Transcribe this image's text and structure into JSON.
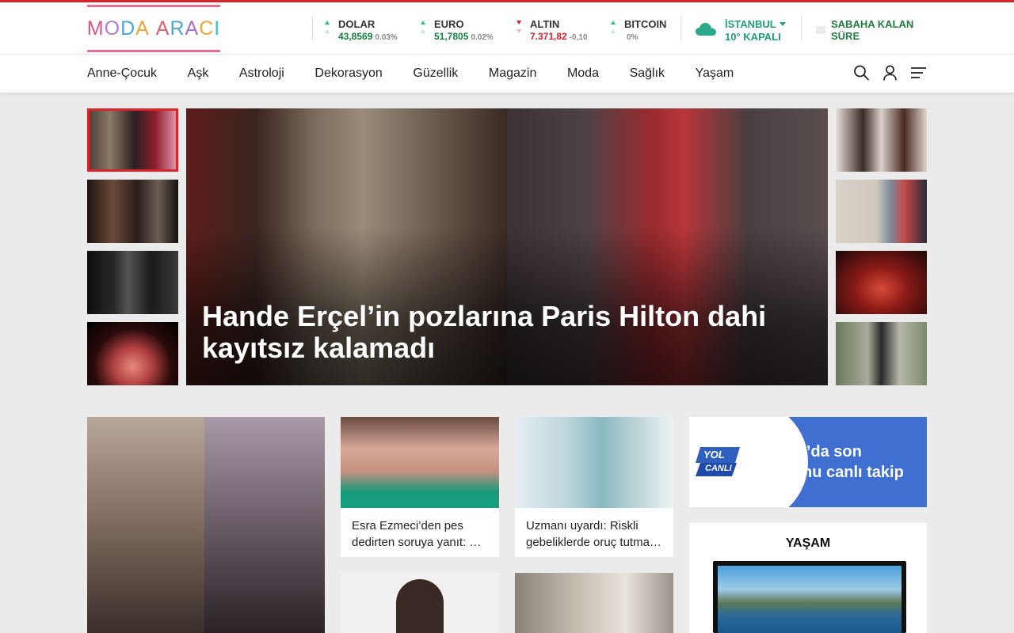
{
  "header": {
    "logo_letters": [
      {
        "ch": "M",
        "color": "#d6538c"
      },
      {
        "ch": "O",
        "color": "#b57ccd"
      },
      {
        "ch": "D",
        "color": "#4ea3d8"
      },
      {
        "ch": "A",
        "color": "#f0a33a"
      },
      {
        "ch": " ",
        "color": "#ffffff"
      },
      {
        "ch": "A",
        "color": "#e25f6b"
      },
      {
        "ch": "R",
        "color": "#4ea3d8"
      },
      {
        "ch": "A",
        "color": "#a46ed0"
      },
      {
        "ch": "C",
        "color": "#f0a33a"
      },
      {
        "ch": "I",
        "color": "#3cc0c8"
      }
    ],
    "markets": [
      {
        "name": "DOLAR",
        "value": "43,8569",
        "change": "0.03%",
        "trend": "up"
      },
      {
        "name": "EURO",
        "value": "51,7805",
        "change": "0.02%",
        "trend": "up"
      },
      {
        "name": "ALTIN",
        "value": "7.371,82",
        "change": "-0,10",
        "trend": "down"
      },
      {
        "name": "BITCOIN",
        "value": "",
        "change": "0%",
        "trend": "up"
      }
    ],
    "weather": {
      "city": "İSTANBUL",
      "temp": "10°",
      "condition": "KAPALI"
    },
    "prayer": {
      "label": "SABAHA KALAN SÜRE"
    }
  },
  "nav": {
    "items": [
      "Anne-Çocuk",
      "Aşk",
      "Astroloji",
      "Dekorasyon",
      "Güzellik",
      "Magazin",
      "Moda",
      "Sağlık",
      "Yaşam"
    ]
  },
  "slider": {
    "headline": "Hande Erçel’in pozlarına Paris Hilton dahi kayıtsız kalamadı"
  },
  "cards": [
    {
      "title": "Esra Ezmeci’den pes dedirten soruya yanıt: …"
    },
    {
      "title": "Uzmanı uyardı: Riskli gebeliklerde oruç tutma…"
    }
  ],
  "traffic": {
    "badge_top": "YOL",
    "badge_bottom": "CANLI",
    "text": "Yollar’da son durumu canlı takip et!"
  },
  "sidebar": {
    "section_title": "YAŞAM"
  },
  "colors": {
    "accent": "#d8242b",
    "up": "#137f3d",
    "down": "#d8242b",
    "weather": "#1f9f76",
    "traffic_blue": "#3f6fd1"
  }
}
